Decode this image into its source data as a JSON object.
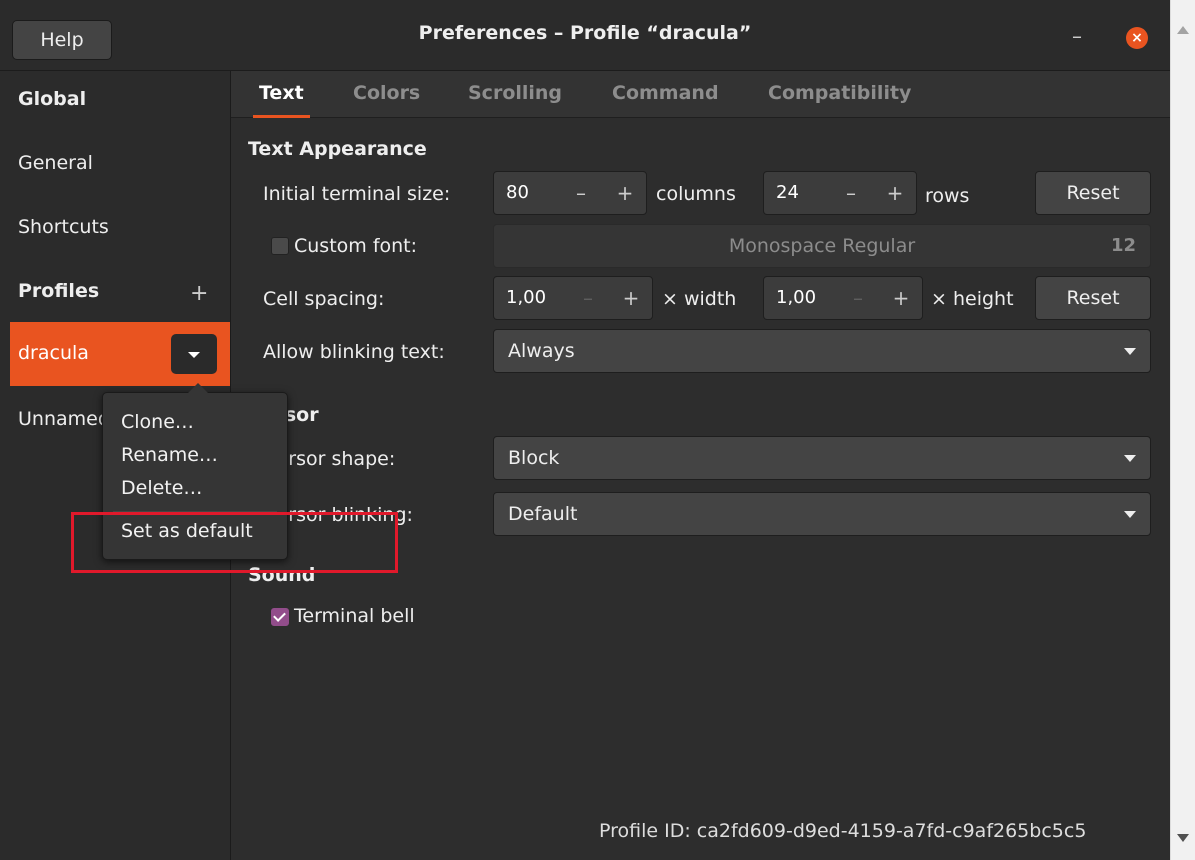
{
  "header": {
    "help_label": "Help",
    "title": "Preferences – Profile “dracula”",
    "minimize_glyph": "–",
    "close_glyph": "×"
  },
  "sidebar": {
    "global_heading": "Global",
    "general": "General",
    "shortcuts": "Shortcuts",
    "profiles_heading": "Profiles",
    "add_glyph": "+",
    "active_profile": "dracula",
    "other_profile": "Unnamed"
  },
  "popover_menu": {
    "items": [
      "Clone…",
      "Rename…",
      "Delete…",
      "Set as default"
    ]
  },
  "tabs": [
    "Text",
    "Colors",
    "Scrolling",
    "Command",
    "Compatibility"
  ],
  "text_appearance": {
    "heading": "Text Appearance",
    "initial_size_label": "Initial terminal size:",
    "columns_value": "80",
    "columns_unit": "columns",
    "rows_value": "24",
    "rows_unit": "rows",
    "reset_label": "Reset",
    "custom_font_label": "Custom font:",
    "custom_font_checked": false,
    "font_name": "Monospace Regular",
    "font_size": "12",
    "cell_spacing_label": "Cell spacing:",
    "width_value": "1,00",
    "width_unit": "× width",
    "height_value": "1,00",
    "height_unit": "× height",
    "blinking_label": "Allow blinking text:",
    "blinking_value": "Always"
  },
  "cursor": {
    "heading": "Cursor",
    "shape_label": "Cursor shape:",
    "shape_value": "Block",
    "blinking_label": "Cursor blinking:",
    "blinking_value": "Default"
  },
  "sound": {
    "heading": "Sound",
    "terminal_bell_label": "Terminal bell",
    "terminal_bell_checked": true
  },
  "footer": {
    "profile_id": "Profile ID: ca2fd609-d9ed-4159-a7fd-c9af265bc5c5"
  },
  "glyphs": {
    "minus": "–",
    "plus": "+"
  },
  "colors": {
    "accent": "#e95420",
    "window_bg": "#2d2d2d",
    "check_accent": "#924d8b",
    "annotation": "#e0192b"
  }
}
